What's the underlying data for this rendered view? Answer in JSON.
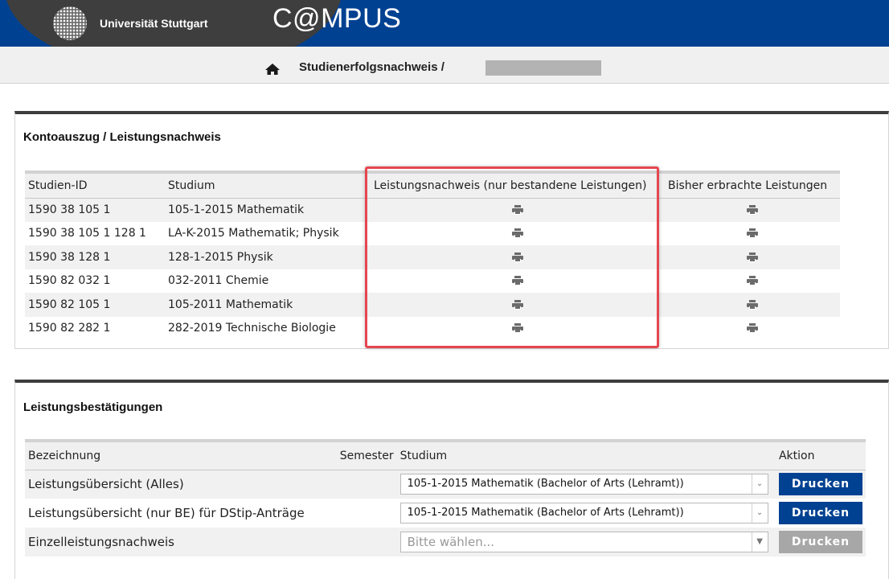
{
  "header": {
    "university": "Universität Stuttgart",
    "app_title": "C@MPUS",
    "brand_color": "#004191"
  },
  "breadcrumb": {
    "home_icon": "home-icon",
    "current": "Studienerfolgsnachweis /"
  },
  "kontoauszug": {
    "title": "Kontoauszug / Leistungsnachweis",
    "columns": [
      "Studien-ID",
      "Studium",
      "Leistungsnachweis (nur bestandene Leistungen)",
      "Bisher erbrachte Leistungen"
    ],
    "rows": [
      {
        "id": "1590 38 105 1",
        "studium": "105-1-2015 Mathematik"
      },
      {
        "id": "1590 38 105 1 128 1",
        "studium": "LA-K-2015 Mathematik; Physik"
      },
      {
        "id": "1590 38 128 1",
        "studium": "128-1-2015 Physik"
      },
      {
        "id": "1590 82 032 1",
        "studium": "032-2011 Chemie"
      },
      {
        "id": "1590 82 105 1",
        "studium": "105-2011 Mathematik"
      },
      {
        "id": "1590 82 282 1",
        "studium": "282-2019 Technische Biologie"
      }
    ],
    "print_icon": "printer-icon"
  },
  "leistungsbestaetigungen": {
    "title": "Leistungsbestätigungen",
    "columns": [
      "Bezeichnung",
      "Semester",
      "Studium",
      "Aktion"
    ],
    "rows": [
      {
        "bezeichnung": "Leistungsübersicht (Alles)",
        "semester": "",
        "studium": "105-1-2015 Mathematik (Bachelor of Arts (Lehramt))",
        "action": "Drucken",
        "enabled": true
      },
      {
        "bezeichnung": "Leistungsübersicht (nur BE) für DStip-Anträge",
        "semester": "",
        "studium": "105-1-2015 Mathematik (Bachelor of Arts (Lehramt))",
        "action": "Drucken",
        "enabled": true
      },
      {
        "bezeichnung": "Einzelleistungsnachweis",
        "semester": "",
        "studium": "",
        "placeholder": "Bitte wählen...",
        "action": "Drucken",
        "enabled": false
      }
    ]
  },
  "colors": {
    "highlight": "#e5474f",
    "button": "#004191",
    "button_disabled": "#a7a7a7"
  }
}
